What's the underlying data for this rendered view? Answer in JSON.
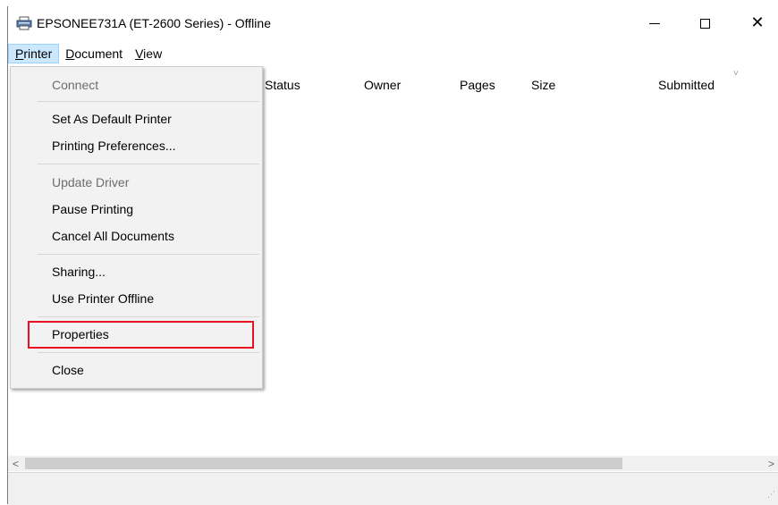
{
  "window": {
    "title": "EPSONEE731A (ET-2600 Series) - Offline",
    "icon": "printer-icon",
    "controls": {
      "minimize": "minimize-icon",
      "maximize": "maximize-icon",
      "close_glyph": "✕"
    }
  },
  "menubar": {
    "items": [
      {
        "mnemonic": "P",
        "rest": "rinter",
        "active": true
      },
      {
        "mnemonic": "D",
        "rest": "ocument",
        "active": false
      },
      {
        "mnemonic": "V",
        "rest": "iew",
        "active": false
      }
    ]
  },
  "columns": {
    "status": "Status",
    "owner": "Owner",
    "pages": "Pages",
    "size": "Size",
    "submitted": "Submitted",
    "sort_indicator": "˅"
  },
  "printer_menu": {
    "items": [
      {
        "label": "Connect",
        "enabled": false
      },
      {
        "label": "Set As Default Printer",
        "enabled": true
      },
      {
        "label": "Printing Preferences...",
        "enabled": true
      },
      {
        "label": "Update Driver",
        "enabled": false
      },
      {
        "label": "Pause Printing",
        "enabled": true
      },
      {
        "label": "Cancel All Documents",
        "enabled": true
      },
      {
        "label": "Sharing...",
        "enabled": true
      },
      {
        "label": "Use Printer Offline",
        "enabled": true
      },
      {
        "label": "Properties",
        "enabled": true,
        "highlighted": true
      },
      {
        "label": "Close",
        "enabled": true
      }
    ],
    "highlight_color": "#e81123"
  },
  "scrollbar": {
    "left_arrow": "<",
    "right_arrow": ">"
  },
  "colors": {
    "menu_active_bg": "#cce8ff",
    "menu_bg": "#f2f2f2",
    "disabled_text": "#6d6d6d"
  }
}
